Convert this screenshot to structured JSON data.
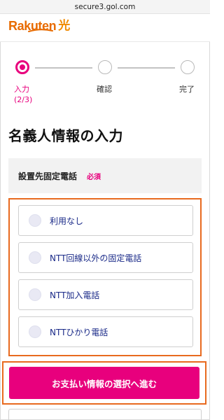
{
  "browser": {
    "url": "secure3.gol.com"
  },
  "brand": {
    "word": "Rakuten",
    "hikari": "光",
    "color": "#e86b00"
  },
  "stepper": {
    "steps": [
      {
        "label": "入力",
        "sub": "(2/3)",
        "state": "active"
      },
      {
        "label": "確認",
        "state": "pending"
      },
      {
        "label": "完了",
        "state": "pending"
      }
    ]
  },
  "page": {
    "title": "名義人情報の入力"
  },
  "field": {
    "label": "設置先固定電話",
    "required": "必須",
    "options": [
      {
        "label": "利用なし"
      },
      {
        "label": "NTT回線以外の固定電話"
      },
      {
        "label": "NTT加入電話"
      },
      {
        "label": "NTTひかり電話"
      }
    ]
  },
  "actions": {
    "next": "お支払い情報の選択へ進む"
  },
  "colors": {
    "accent": "#e8007d",
    "highlight": "#e86a1f",
    "option_text": "#1a2a88"
  }
}
